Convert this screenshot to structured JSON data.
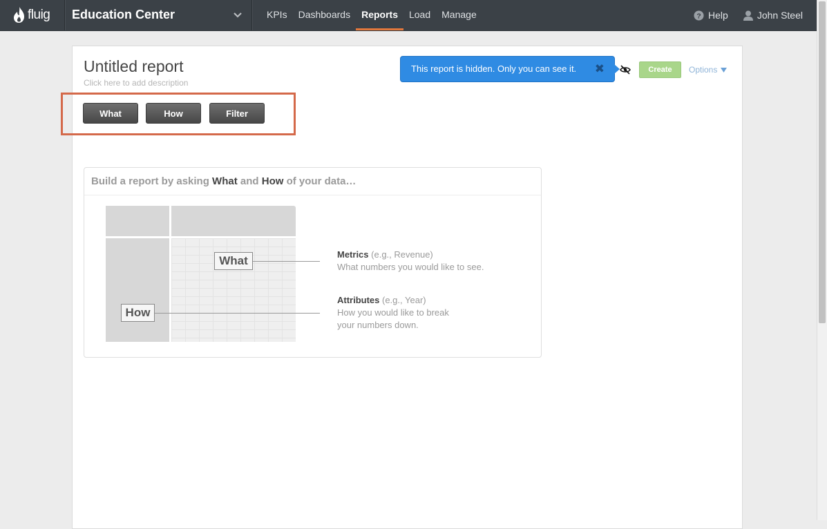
{
  "header": {
    "logo_text": "fluig",
    "project_name": "Education Center",
    "nav": [
      {
        "label": "KPIs",
        "active": false
      },
      {
        "label": "Dashboards",
        "active": false
      },
      {
        "label": "Reports",
        "active": true
      },
      {
        "label": "Load",
        "active": false
      },
      {
        "label": "Manage",
        "active": false
      }
    ],
    "help_label": "Help",
    "user_name": "John Steel"
  },
  "report": {
    "title": "Untitled report",
    "description_placeholder": "Click here to add description",
    "buttons": {
      "what": "What",
      "how": "How",
      "filter": "Filter"
    },
    "visibility_tooltip": "This report is hidden. Only you can see it.",
    "tooltip_close": "✖",
    "create_label": "Create",
    "options_label": "Options"
  },
  "explainer": {
    "heading_prefix": "Build a report by asking ",
    "heading_what": "What",
    "heading_and": " and ",
    "heading_how": "How",
    "heading_suffix": " of your data…",
    "diagram_what": "What",
    "diagram_how": "How",
    "metrics_title": "Metrics",
    "metrics_example": " (e.g., Revenue)",
    "metrics_desc": "What numbers you would like to see.",
    "attributes_title": "Attributes",
    "attributes_example": " (e.g., Year)",
    "attributes_desc_line1": "How you would like to break",
    "attributes_desc_line2": "your numbers down."
  },
  "colors": {
    "topbar": "#3b4147",
    "nav_active_underline": "#e3783c",
    "tooltip_bg": "#2f8be3",
    "create_button": "#a9d68a",
    "highlight_box": "#d4694a"
  }
}
